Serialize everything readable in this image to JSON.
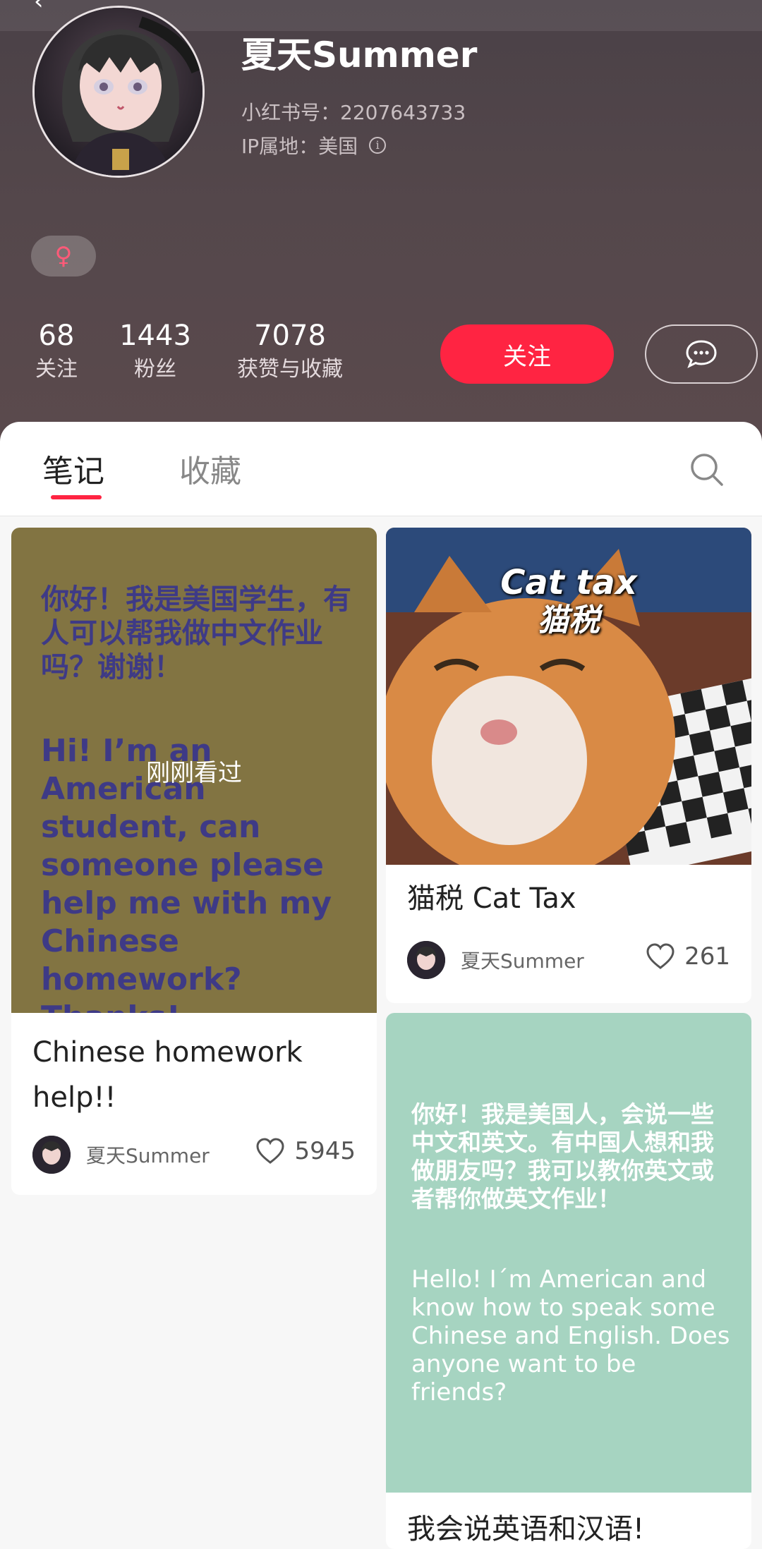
{
  "profile": {
    "name": "夏天Summer",
    "red_id": "小红书号：2207643733",
    "ip_location": "IP属地：美国",
    "gender_symbol": "♀"
  },
  "stats": [
    {
      "value": "68",
      "label": "关注"
    },
    {
      "value": "1443",
      "label": "粉丝"
    },
    {
      "value": "7078",
      "label": "获赞与收藏"
    }
  ],
  "actions": {
    "follow_label": "关注"
  },
  "tabs": [
    {
      "label": "笔记",
      "active": true
    },
    {
      "label": "收藏",
      "active": false
    }
  ],
  "notes": [
    {
      "title": "Chinese homework help!!",
      "author": "夏天Summer",
      "likes": "5945",
      "recently_viewed": "刚刚看过",
      "image_text_cn": "你好！我是美国学生，有人可以帮我做中文作业吗？谢谢！",
      "image_text_en": "Hi! I’m an American student, can someone please help me with my Chinese homework? Thanks!",
      "bg_color": "#827442"
    },
    {
      "title": "猫税 Cat Tax",
      "author": "夏天Summer",
      "likes": "261",
      "image_text_en": "Cat tax",
      "image_text_cn": "猫税"
    },
    {
      "title": "我会说英语和汉语!",
      "image_text_cn": "你好！我是美国人，会说一些中文和英文。有中国人想和我做朋友吗？我可以教你英文或者帮你做英文作业！",
      "image_text_en": "Hello! I´m American and know how to speak some Chinese and English. Does anyone want to be friends?",
      "bg_color": "#a6d4c1"
    }
  ],
  "colors": {
    "accent": "#ff2442",
    "header_bg": "#54474b"
  }
}
